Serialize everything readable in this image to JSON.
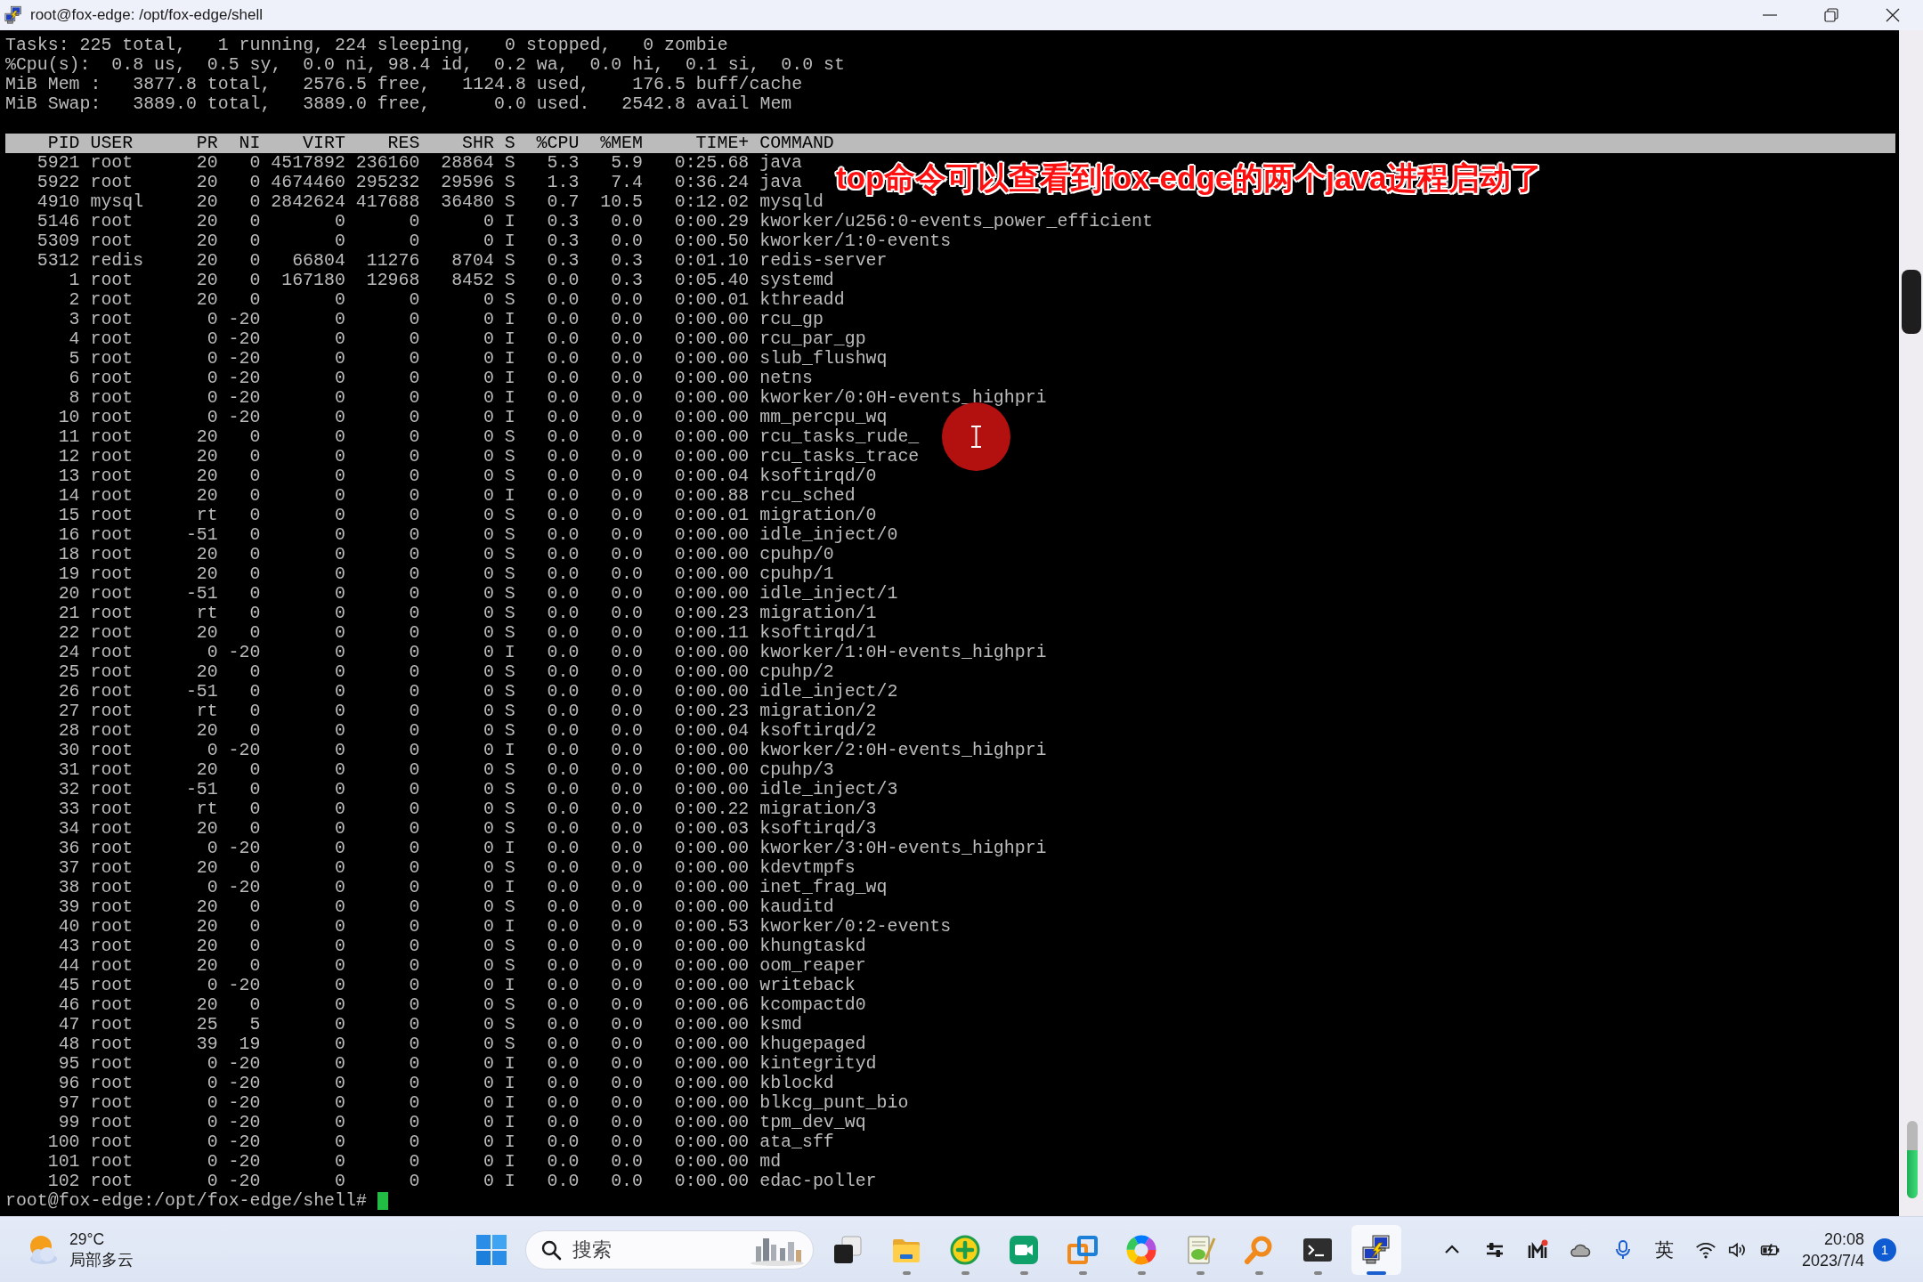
{
  "window": {
    "title": "root@fox-edge: /opt/fox-edge/shell"
  },
  "terminal": {
    "summary_lines": [
      "Tasks: 225 total,   1 running, 224 sleeping,   0 stopped,   0 zombie",
      "%Cpu(s):  0.8 us,  0.5 sy,  0.0 ni, 98.4 id,  0.2 wa,  0.0 hi,  0.1 si,  0.0 st",
      "MiB Mem :   3877.8 total,   2576.5 free,   1124.8 used,    176.5 buff/cache",
      "MiB Swap:   3889.0 total,   3889.0 free,      0.0 used.   2542.8 avail Mem"
    ],
    "table": {
      "columns": [
        "PID",
        "USER",
        "PR",
        "NI",
        "VIRT",
        "RES",
        "SHR",
        "S",
        "%CPU",
        "%MEM",
        "TIME+",
        "COMMAND"
      ],
      "rows": [
        [
          "5921",
          "root",
          "20",
          "0",
          "4517892",
          "236160",
          "28864",
          "S",
          "5.3",
          "5.9",
          "0:25.68",
          "java"
        ],
        [
          "5922",
          "root",
          "20",
          "0",
          "4674460",
          "295232",
          "29596",
          "S",
          "1.3",
          "7.4",
          "0:36.24",
          "java"
        ],
        [
          "4910",
          "mysql",
          "20",
          "0",
          "2842624",
          "417688",
          "36480",
          "S",
          "0.7",
          "10.5",
          "0:12.02",
          "mysqld"
        ],
        [
          "5146",
          "root",
          "20",
          "0",
          "0",
          "0",
          "0",
          "I",
          "0.3",
          "0.0",
          "0:00.29",
          "kworker/u256:0-events_power_efficient"
        ],
        [
          "5309",
          "root",
          "20",
          "0",
          "0",
          "0",
          "0",
          "I",
          "0.3",
          "0.0",
          "0:00.50",
          "kworker/1:0-events"
        ],
        [
          "5312",
          "redis",
          "20",
          "0",
          "66804",
          "11276",
          "8704",
          "S",
          "0.3",
          "0.3",
          "0:01.10",
          "redis-server"
        ],
        [
          "1",
          "root",
          "20",
          "0",
          "167180",
          "12968",
          "8452",
          "S",
          "0.0",
          "0.3",
          "0:05.40",
          "systemd"
        ],
        [
          "2",
          "root",
          "20",
          "0",
          "0",
          "0",
          "0",
          "S",
          "0.0",
          "0.0",
          "0:00.01",
          "kthreadd"
        ],
        [
          "3",
          "root",
          "0",
          "-20",
          "0",
          "0",
          "0",
          "I",
          "0.0",
          "0.0",
          "0:00.00",
          "rcu_gp"
        ],
        [
          "4",
          "root",
          "0",
          "-20",
          "0",
          "0",
          "0",
          "I",
          "0.0",
          "0.0",
          "0:00.00",
          "rcu_par_gp"
        ],
        [
          "5",
          "root",
          "0",
          "-20",
          "0",
          "0",
          "0",
          "I",
          "0.0",
          "0.0",
          "0:00.00",
          "slub_flushwq"
        ],
        [
          "6",
          "root",
          "0",
          "-20",
          "0",
          "0",
          "0",
          "I",
          "0.0",
          "0.0",
          "0:00.00",
          "netns"
        ],
        [
          "8",
          "root",
          "0",
          "-20",
          "0",
          "0",
          "0",
          "I",
          "0.0",
          "0.0",
          "0:00.00",
          "kworker/0:0H-events_highpri"
        ],
        [
          "10",
          "root",
          "0",
          "-20",
          "0",
          "0",
          "0",
          "I",
          "0.0",
          "0.0",
          "0:00.00",
          "mm_percpu_wq"
        ],
        [
          "11",
          "root",
          "20",
          "0",
          "0",
          "0",
          "0",
          "S",
          "0.0",
          "0.0",
          "0:00.00",
          "rcu_tasks_rude_"
        ],
        [
          "12",
          "root",
          "20",
          "0",
          "0",
          "0",
          "0",
          "S",
          "0.0",
          "0.0",
          "0:00.00",
          "rcu_tasks_trace"
        ],
        [
          "13",
          "root",
          "20",
          "0",
          "0",
          "0",
          "0",
          "S",
          "0.0",
          "0.0",
          "0:00.04",
          "ksoftirqd/0"
        ],
        [
          "14",
          "root",
          "20",
          "0",
          "0",
          "0",
          "0",
          "I",
          "0.0",
          "0.0",
          "0:00.88",
          "rcu_sched"
        ],
        [
          "15",
          "root",
          "rt",
          "0",
          "0",
          "0",
          "0",
          "S",
          "0.0",
          "0.0",
          "0:00.01",
          "migration/0"
        ],
        [
          "16",
          "root",
          "-51",
          "0",
          "0",
          "0",
          "0",
          "S",
          "0.0",
          "0.0",
          "0:00.00",
          "idle_inject/0"
        ],
        [
          "18",
          "root",
          "20",
          "0",
          "0",
          "0",
          "0",
          "S",
          "0.0",
          "0.0",
          "0:00.00",
          "cpuhp/0"
        ],
        [
          "19",
          "root",
          "20",
          "0",
          "0",
          "0",
          "0",
          "S",
          "0.0",
          "0.0",
          "0:00.00",
          "cpuhp/1"
        ],
        [
          "20",
          "root",
          "-51",
          "0",
          "0",
          "0",
          "0",
          "S",
          "0.0",
          "0.0",
          "0:00.00",
          "idle_inject/1"
        ],
        [
          "21",
          "root",
          "rt",
          "0",
          "0",
          "0",
          "0",
          "S",
          "0.0",
          "0.0",
          "0:00.23",
          "migration/1"
        ],
        [
          "22",
          "root",
          "20",
          "0",
          "0",
          "0",
          "0",
          "S",
          "0.0",
          "0.0",
          "0:00.11",
          "ksoftirqd/1"
        ],
        [
          "24",
          "root",
          "0",
          "-20",
          "0",
          "0",
          "0",
          "I",
          "0.0",
          "0.0",
          "0:00.00",
          "kworker/1:0H-events_highpri"
        ],
        [
          "25",
          "root",
          "20",
          "0",
          "0",
          "0",
          "0",
          "S",
          "0.0",
          "0.0",
          "0:00.00",
          "cpuhp/2"
        ],
        [
          "26",
          "root",
          "-51",
          "0",
          "0",
          "0",
          "0",
          "S",
          "0.0",
          "0.0",
          "0:00.00",
          "idle_inject/2"
        ],
        [
          "27",
          "root",
          "rt",
          "0",
          "0",
          "0",
          "0",
          "S",
          "0.0",
          "0.0",
          "0:00.23",
          "migration/2"
        ],
        [
          "28",
          "root",
          "20",
          "0",
          "0",
          "0",
          "0",
          "S",
          "0.0",
          "0.0",
          "0:00.04",
          "ksoftirqd/2"
        ],
        [
          "30",
          "root",
          "0",
          "-20",
          "0",
          "0",
          "0",
          "I",
          "0.0",
          "0.0",
          "0:00.00",
          "kworker/2:0H-events_highpri"
        ],
        [
          "31",
          "root",
          "20",
          "0",
          "0",
          "0",
          "0",
          "S",
          "0.0",
          "0.0",
          "0:00.00",
          "cpuhp/3"
        ],
        [
          "32",
          "root",
          "-51",
          "0",
          "0",
          "0",
          "0",
          "S",
          "0.0",
          "0.0",
          "0:00.00",
          "idle_inject/3"
        ],
        [
          "33",
          "root",
          "rt",
          "0",
          "0",
          "0",
          "0",
          "S",
          "0.0",
          "0.0",
          "0:00.22",
          "migration/3"
        ],
        [
          "34",
          "root",
          "20",
          "0",
          "0",
          "0",
          "0",
          "S",
          "0.0",
          "0.0",
          "0:00.03",
          "ksoftirqd/3"
        ],
        [
          "36",
          "root",
          "0",
          "-20",
          "0",
          "0",
          "0",
          "I",
          "0.0",
          "0.0",
          "0:00.00",
          "kworker/3:0H-events_highpri"
        ],
        [
          "37",
          "root",
          "20",
          "0",
          "0",
          "0",
          "0",
          "S",
          "0.0",
          "0.0",
          "0:00.00",
          "kdevtmpfs"
        ],
        [
          "38",
          "root",
          "0",
          "-20",
          "0",
          "0",
          "0",
          "I",
          "0.0",
          "0.0",
          "0:00.00",
          "inet_frag_wq"
        ],
        [
          "39",
          "root",
          "20",
          "0",
          "0",
          "0",
          "0",
          "S",
          "0.0",
          "0.0",
          "0:00.00",
          "kauditd"
        ],
        [
          "40",
          "root",
          "20",
          "0",
          "0",
          "0",
          "0",
          "I",
          "0.0",
          "0.0",
          "0:00.53",
          "kworker/0:2-events"
        ],
        [
          "43",
          "root",
          "20",
          "0",
          "0",
          "0",
          "0",
          "S",
          "0.0",
          "0.0",
          "0:00.00",
          "khungtaskd"
        ],
        [
          "44",
          "root",
          "20",
          "0",
          "0",
          "0",
          "0",
          "S",
          "0.0",
          "0.0",
          "0:00.00",
          "oom_reaper"
        ],
        [
          "45",
          "root",
          "0",
          "-20",
          "0",
          "0",
          "0",
          "I",
          "0.0",
          "0.0",
          "0:00.00",
          "writeback"
        ],
        [
          "46",
          "root",
          "20",
          "0",
          "0",
          "0",
          "0",
          "S",
          "0.0",
          "0.0",
          "0:00.06",
          "kcompactd0"
        ],
        [
          "47",
          "root",
          "25",
          "5",
          "0",
          "0",
          "0",
          "S",
          "0.0",
          "0.0",
          "0:00.00",
          "ksmd"
        ],
        [
          "48",
          "root",
          "39",
          "19",
          "0",
          "0",
          "0",
          "S",
          "0.0",
          "0.0",
          "0:00.00",
          "khugepaged"
        ],
        [
          "95",
          "root",
          "0",
          "-20",
          "0",
          "0",
          "0",
          "I",
          "0.0",
          "0.0",
          "0:00.00",
          "kintegrityd"
        ],
        [
          "96",
          "root",
          "0",
          "-20",
          "0",
          "0",
          "0",
          "I",
          "0.0",
          "0.0",
          "0:00.00",
          "kblockd"
        ],
        [
          "97",
          "root",
          "0",
          "-20",
          "0",
          "0",
          "0",
          "I",
          "0.0",
          "0.0",
          "0:00.00",
          "blkcg_punt_bio"
        ],
        [
          "99",
          "root",
          "0",
          "-20",
          "0",
          "0",
          "0",
          "I",
          "0.0",
          "0.0",
          "0:00.00",
          "tpm_dev_wq"
        ],
        [
          "100",
          "root",
          "0",
          "-20",
          "0",
          "0",
          "0",
          "I",
          "0.0",
          "0.0",
          "0:00.00",
          "ata_sff"
        ],
        [
          "101",
          "root",
          "0",
          "-20",
          "0",
          "0",
          "0",
          "I",
          "0.0",
          "0.0",
          "0:00.00",
          "md"
        ],
        [
          "102",
          "root",
          "0",
          "-20",
          "0",
          "0",
          "0",
          "I",
          "0.0",
          "0.0",
          "0:00.00",
          "edac-poller"
        ]
      ]
    },
    "prompt": "root@fox-edge:/opt/fox-edge/shell#",
    "annotation": "top命令可以查看到fox-edge的两个java进程启动了"
  },
  "taskbar": {
    "weather": {
      "temperature": "29°C",
      "condition": "局部多云"
    },
    "search": {
      "placeholder": "搜索"
    },
    "apps": [
      {
        "kind": "taskview",
        "running": false,
        "selected": false
      },
      {
        "kind": "explorer",
        "running": true,
        "selected": false
      },
      {
        "kind": "plus",
        "running": true,
        "selected": false
      },
      {
        "kind": "video",
        "running": true,
        "selected": false
      },
      {
        "kind": "squares",
        "running": true,
        "selected": false
      },
      {
        "kind": "ring",
        "running": true,
        "selected": false
      },
      {
        "kind": "notepad",
        "running": true,
        "selected": false
      },
      {
        "kind": "magnifier",
        "running": true,
        "selected": false
      },
      {
        "kind": "terminal",
        "running": true,
        "selected": false
      },
      {
        "kind": "putty",
        "running": true,
        "selected": true
      }
    ],
    "tray": {
      "input_language": "英",
      "time": "20:08",
      "date": "2023/7/4",
      "notifications": "1"
    }
  }
}
